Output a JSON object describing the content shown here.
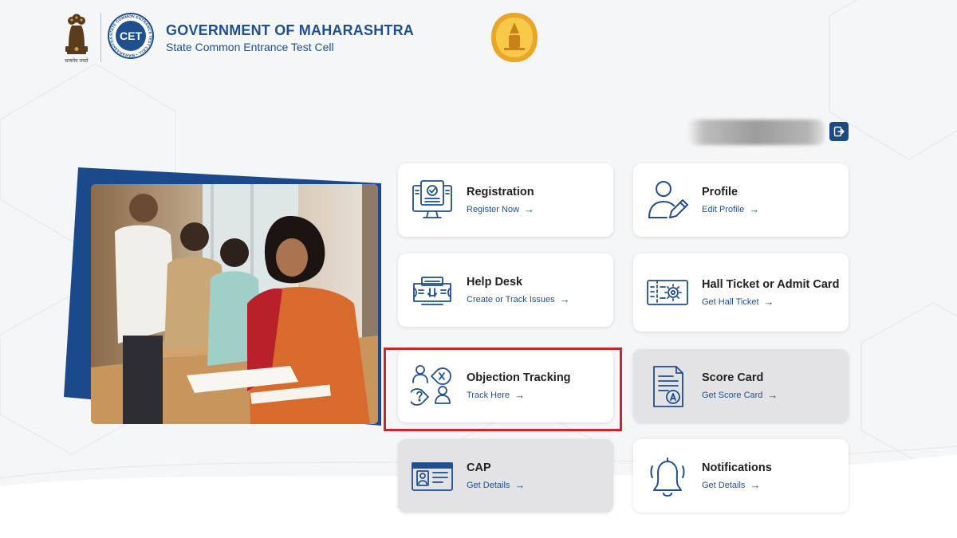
{
  "header": {
    "title": "GOVERNMENT OF MAHARASHTRA",
    "subtitle": "State Common Entrance Test Cell",
    "emblem_caption": "सत्यमेव जयते",
    "cet_logo_text": "CET",
    "cet_logo_ring": "STATE COMMON ENTRANCE TEST CELL • MAHARASHTRA •"
  },
  "logout_icon": "logout-icon",
  "colors": {
    "brand_blue": "#1f4f8f",
    "highlight_red": "#d3232a",
    "card_grey": "#e3e3e5"
  },
  "cards": [
    {
      "title": "Registration",
      "link": "Register Now",
      "icon": "registration-icon"
    },
    {
      "title": "Profile",
      "link": "Edit Profile",
      "icon": "user-edit-icon"
    },
    {
      "title": "Help Desk",
      "link": "Create or Track Issues",
      "icon": "help-desk-icon"
    },
    {
      "title": "Hall Ticket or Admit Card",
      "link": "Get Hall Ticket",
      "icon": "hall-ticket-icon"
    },
    {
      "title": "Objection Tracking",
      "link": "Track Here",
      "icon": "objection-icon"
    },
    {
      "title": "Score Card",
      "link": "Get Score Card",
      "icon": "score-card-icon"
    },
    {
      "title": "CAP",
      "link": "Get Details",
      "icon": "id-card-icon"
    },
    {
      "title": "Notifications",
      "link": "Get Details",
      "icon": "bell-icon"
    }
  ],
  "arrow_glyph": "→"
}
